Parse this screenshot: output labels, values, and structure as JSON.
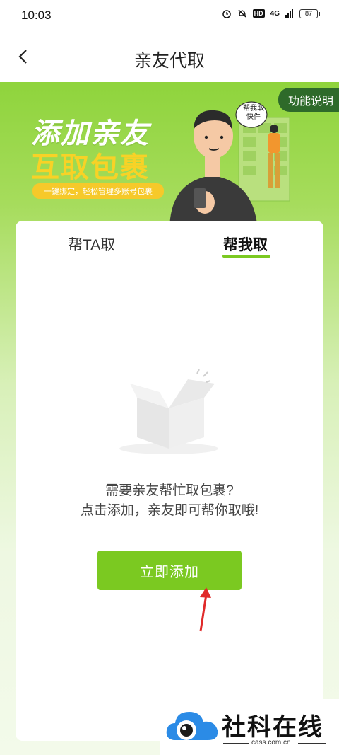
{
  "status_bar": {
    "time": "10:03",
    "hd": "HD",
    "network": "4G",
    "battery": "87",
    "icons": [
      "alarm-icon",
      "bell-muted-icon",
      "signal-icon"
    ]
  },
  "nav": {
    "title": "亲友代取",
    "back_icon": "chevron-left-icon"
  },
  "banner": {
    "line1": "添加亲友",
    "line2": "互取包裹",
    "slogan": "一键绑定，轻松管理多账号包裹",
    "feature_button": "功能说明",
    "speech_bubble": "帮我取快件",
    "colors": {
      "title": "#ffffff",
      "highlight": "#f8d226",
      "accent": "#7bc921"
    }
  },
  "tabs": [
    {
      "label": "帮TA取",
      "active": false
    },
    {
      "label": "帮我取",
      "active": true
    }
  ],
  "empty_state": {
    "icon": "empty-box-icon",
    "line1": "需要亲友帮忙取包裹?",
    "line2": "点击添加，亲友即可帮你取哦!"
  },
  "add_button": {
    "label": "立即添加"
  },
  "watermark": {
    "name": "社科在线",
    "domain": "cass.com.cn"
  }
}
